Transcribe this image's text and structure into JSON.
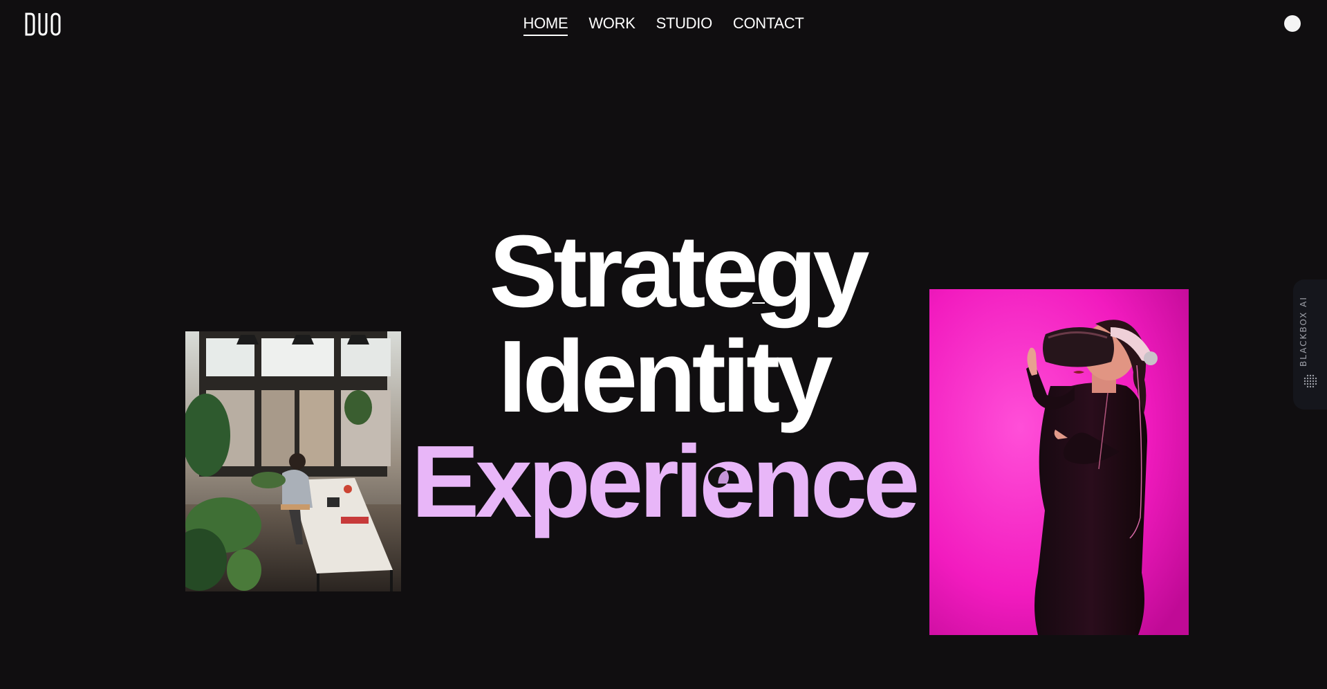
{
  "header": {
    "logo_text": "DUO",
    "nav": [
      {
        "label": "HOME",
        "active": true
      },
      {
        "label": "WORK",
        "active": false
      },
      {
        "label": "STUDIO",
        "active": false
      },
      {
        "label": "CONTACT",
        "active": false
      }
    ],
    "theme_toggle_icon": "circle-toggle-icon"
  },
  "hero": {
    "line1": "Strategy",
    "line2": "Identity",
    "line3": "Experience",
    "accent_color": "#e8b6f8"
  },
  "images": {
    "left": {
      "subject": "office-workspace-photo",
      "tone": "warm-natural"
    },
    "right": {
      "subject": "vr-headset-person-photo",
      "background": "#ff2bd0"
    }
  },
  "side_tab": {
    "label": "BLACKBOX AI",
    "icon": "dots-sphere-icon"
  },
  "colors": {
    "background": "#100e10",
    "text": "#ffffff",
    "accent": "#e8b6f8",
    "magenta": "#ff2bd0"
  }
}
